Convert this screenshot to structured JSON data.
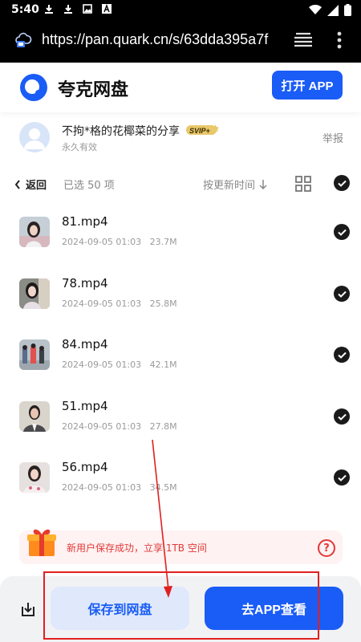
{
  "status_bar": {
    "time": "5:40",
    "left_icons": [
      "download-icon",
      "download-icon",
      "image-icon",
      "text-a-icon"
    ],
    "right_icons": [
      "wifi-icon",
      "signal-icon",
      "battery-icon"
    ]
  },
  "browser": {
    "url": "https://pan.quark.cn/s/63dda395a7f"
  },
  "app_header": {
    "title": "夸克网盘",
    "open_app_label": "打开 APP",
    "brand_color": "#1a5cf6"
  },
  "sharer": {
    "name": "不拘*格的花椰菜的分享",
    "badge": "SVIP+",
    "validity": "永久有效",
    "report_label": "举报"
  },
  "toolbar": {
    "back_label": "返回",
    "selected_label": "已选 50 项",
    "sort_label": "按更新时间"
  },
  "files": [
    {
      "name": "81.mp4",
      "date": "2024-09-05 01:03",
      "size": "23.7M"
    },
    {
      "name": "78.mp4",
      "date": "2024-09-05 01:03",
      "size": "25.8M"
    },
    {
      "name": "84.mp4",
      "date": "2024-09-05 01:03",
      "size": "42.1M"
    },
    {
      "name": "51.mp4",
      "date": "2024-09-05 01:03",
      "size": "27.8M"
    },
    {
      "name": "56.mp4",
      "date": "2024-09-05 01:03",
      "size": "34.5M"
    }
  ],
  "promo": {
    "text": "新用户保存成功，立享 1TB 空间",
    "help_label": "?"
  },
  "bottom_bar": {
    "save_label": "保存到网盘",
    "go_app_label": "去APP查看"
  },
  "colors": {
    "accent": "#1a5cf6",
    "promo_red": "#e23838",
    "annotation_red": "#e02020"
  }
}
